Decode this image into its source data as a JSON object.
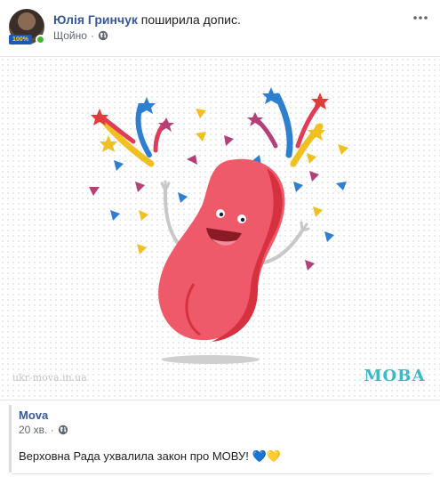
{
  "header": {
    "author": "Юлія Гринчук",
    "action": "поширила допис.",
    "time": "Щойно",
    "avatar_badge": "100%"
  },
  "image": {
    "watermark": "ukr-mova.in.ua",
    "logo": "МОВА"
  },
  "shared": {
    "author": "Mova",
    "time": "20 хв. · ",
    "text": "Верховна Рада ухвалила закон про МОВУ! 💙💛"
  },
  "icons": {
    "more": "more-horizontal-icon",
    "audience": "globe-icon"
  },
  "colors": {
    "link": "#385898",
    "tongue": "#ef5a6b",
    "online": "#42b72a"
  }
}
